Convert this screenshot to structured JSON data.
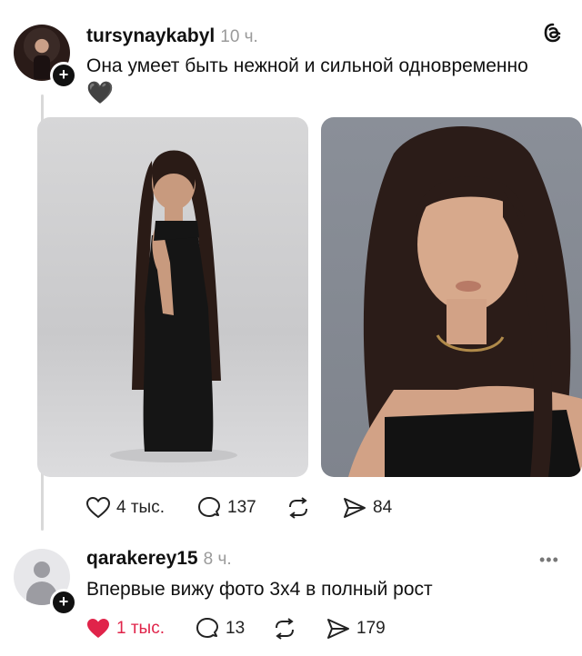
{
  "post": {
    "username": "tursynaykabyl",
    "time": "10 ч.",
    "text": "Она умеет быть нежной и сильной одновременно",
    "emoji": "🖤",
    "actions": {
      "likes": "4 тыс.",
      "comments": "137",
      "reposts": "",
      "shares": "84"
    }
  },
  "reply": {
    "username": "qarakerey15",
    "time": "8 ч.",
    "text": "Впервые вижу фото 3х4 в полный рост",
    "more": "•••",
    "actions": {
      "likes": "1 тыс.",
      "comments": "13",
      "reposts": "",
      "shares": "179"
    }
  },
  "icons": {
    "avatar_badge": "+",
    "threads_logo": "threads-logo-icon",
    "like": "heart-icon",
    "comment": "comment-bubble-icon",
    "repost": "repost-arrows-icon",
    "share": "send-icon"
  },
  "colors": {
    "like_active": "#e0244a",
    "text_muted": "#9a9a9a",
    "thread_line": "#d9d9d9"
  }
}
